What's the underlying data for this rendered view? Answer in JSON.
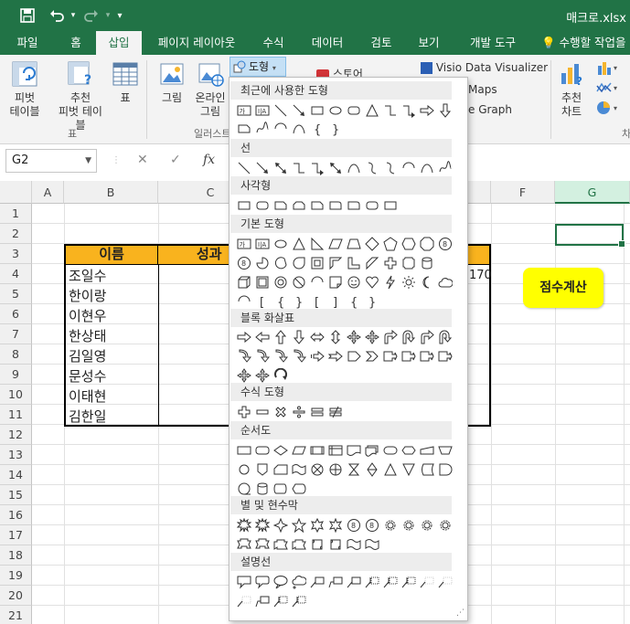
{
  "titlebar": {
    "filename": "매크로.xlsx",
    "customize_glyph": "▾"
  },
  "tabs": [
    {
      "label": "파일"
    },
    {
      "label": "홈"
    },
    {
      "label": "삽입"
    },
    {
      "label": "페이지 레이아웃"
    },
    {
      "label": "수식"
    },
    {
      "label": "데이터"
    },
    {
      "label": "검토"
    },
    {
      "label": "보기"
    },
    {
      "label": "개발 도구"
    }
  ],
  "tellme": "수행할 작업을",
  "ribbon": {
    "pivot_line1": "피벗",
    "pivot_line2": "테이블",
    "rec_pivot_line1": "추천",
    "rec_pivot_line2": "피벗 테이블",
    "table": "표",
    "group_tables": "표",
    "picture": "그림",
    "online_line1": "온라인",
    "online_line2": "그림",
    "group_illustrations": "일러스트",
    "shapes_btn": "도형",
    "store": "스토어",
    "visio": "Visio Data Visualizer",
    "maps": "Maps",
    "graph": "e Graph",
    "rec_chart_line1": "추천",
    "rec_chart_line2": "차트",
    "chart_group_partial": "차"
  },
  "formula": {
    "namebox": "G2",
    "fx": "fx"
  },
  "columns": [
    "A",
    "B",
    "C",
    "F",
    "G"
  ],
  "rows": [
    "1",
    "2",
    "3",
    "4",
    "5",
    "6",
    "7",
    "8",
    "9",
    "10",
    "11",
    "12",
    "13",
    "14",
    "15",
    "16",
    "17",
    "18",
    "19",
    "20",
    "21"
  ],
  "table": {
    "header_name": "이름",
    "header_score": "성과",
    "names": [
      "조일수",
      "한이랑",
      "이현우",
      "한상태",
      "김일영",
      "문성수",
      "이태현",
      "김한일"
    ],
    "e4_value": "170"
  },
  "macro_button": "점수계산",
  "shapes_panel": {
    "sections": [
      {
        "title": "최근에 사용한 도형"
      },
      {
        "title": "선"
      },
      {
        "title": "사각형"
      },
      {
        "title": "기본 도형"
      },
      {
        "title": "블록 화살표"
      },
      {
        "title": "수식 도형"
      },
      {
        "title": "순서도"
      },
      {
        "title": "별 및 현수막"
      },
      {
        "title": "설명선"
      }
    ]
  }
}
